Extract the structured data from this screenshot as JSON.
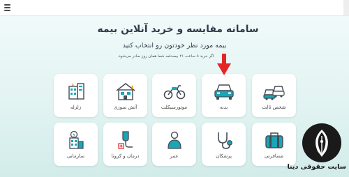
{
  "header": {
    "menu_icon": "hamburger-menu-icon"
  },
  "hero": {
    "title": "سامانه مقایسه و خرید آنلاین بیمه",
    "subtitle": "بیمه مورد نظر خودتون رو انتخاب کنید",
    "note": "اگر خرید تا ساعت ۲۱ بیمه‌نامه شما همان روز صادر می‌شود."
  },
  "insurance_types": [
    {
      "label": "شخص ثالث",
      "icon": "third-party-cars-icon"
    },
    {
      "label": "بدنه",
      "icon": "car-body-icon"
    },
    {
      "label": "موتورسیکلت",
      "icon": "motorcycle-icon"
    },
    {
      "label": "آتش سوزی",
      "icon": "house-fire-icon"
    },
    {
      "label": "زلزله",
      "icon": "earthquake-building-icon"
    },
    {
      "label": "مسافرتی",
      "icon": "suitcase-icon"
    },
    {
      "label": "پزشکان",
      "icon": "stethoscope-icon"
    },
    {
      "label": "عمر",
      "icon": "person-life-icon"
    },
    {
      "label": "درمان و کرونا",
      "icon": "medical-iv-icon"
    },
    {
      "label": "سازمانی",
      "icon": "organization-building-icon"
    }
  ],
  "highlight": {
    "target": "بدنه",
    "color": "#e32626"
  },
  "watermark": {
    "site_name": "سایت حقوقی دینا",
    "logo_icon": "pen-nib-logo-icon"
  },
  "colors": {
    "accent": "#1aa6b7",
    "icon_dark": "#444c56",
    "highlight": "#e32626"
  }
}
